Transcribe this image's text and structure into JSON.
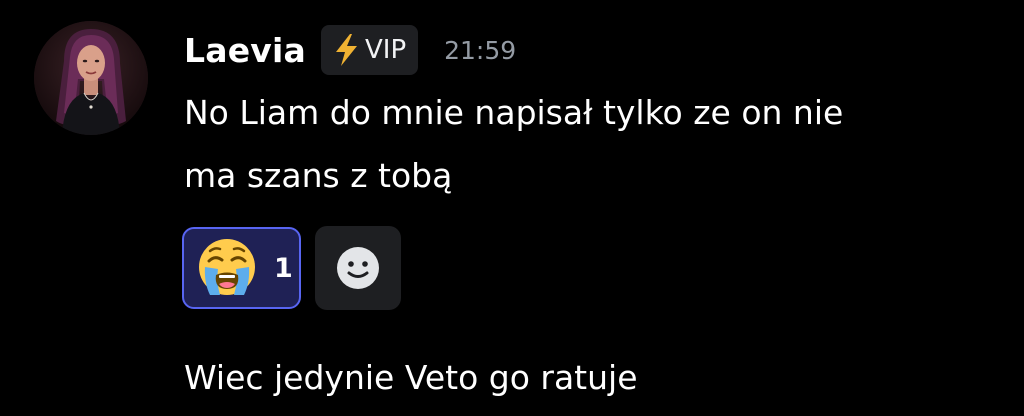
{
  "message": {
    "author": "Laevia",
    "role_badge": {
      "icon": "lightning-bolt-icon",
      "label": "VIP"
    },
    "timestamp": "21:59",
    "content_lines": [
      "No Liam do mnie napisał tylko ze on nie",
      "ma szans z tobą"
    ],
    "reactions": [
      {
        "emoji": "loudly-crying-face",
        "count": "1",
        "selected": true
      }
    ],
    "add_reaction_icon": "add-reaction-smiley-icon"
  },
  "followup_message": {
    "content": "Wiec jedynie Veto go ratuje"
  },
  "colors": {
    "background": "#000000",
    "text": "#ffffff",
    "timestamp": "#949ba4",
    "badge_bg": "#1e1f22",
    "reaction_selected_border": "#5865f2",
    "reaction_selected_bg": "#1f2155",
    "bolt": "#f0b232"
  }
}
